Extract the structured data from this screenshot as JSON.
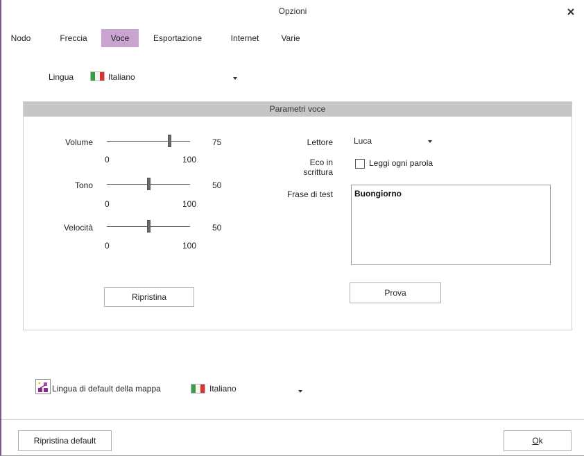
{
  "window": {
    "title": "Opzioni"
  },
  "tabs": [
    {
      "label": "Nodo",
      "active": false
    },
    {
      "label": "Freccia",
      "active": false
    },
    {
      "label": "Voce",
      "active": true
    },
    {
      "label": "Esportazione",
      "active": false
    },
    {
      "label": "Internet",
      "active": false
    },
    {
      "label": "Varie",
      "active": false
    }
  ],
  "language": {
    "label": "Lingua",
    "value": "Italiano",
    "flag": "italy-flag"
  },
  "voice_params": {
    "title": "Parametri voce",
    "volume": {
      "label": "Volume",
      "value": "75",
      "min": "0",
      "max": "100"
    },
    "tone": {
      "label": "Tono",
      "value": "50",
      "min": "0",
      "max": "100"
    },
    "speed": {
      "label": "Velocità",
      "value": "50",
      "min": "0",
      "max": "100"
    },
    "reset_button": "Ripristina",
    "reader": {
      "label": "Lettore",
      "value": "Luca"
    },
    "echo": {
      "label_line1": "Eco in",
      "label_line2": "scrittura",
      "checkbox_label": "Leggi ogni parola",
      "checked": false
    },
    "test_phrase": {
      "label": "Frase di test",
      "value": "Buongiorno"
    },
    "test_button": "Prova"
  },
  "map_language": {
    "label": "Lingua di default della mappa",
    "value": "Italiano",
    "flag": "italy-flag",
    "icon": "map-language-icon"
  },
  "footer": {
    "reset_default": "Ripristina default",
    "ok_accel": "O",
    "ok_rest": "k"
  },
  "colors": {
    "active_tab": "#c9a4d0",
    "group_header": "#c6c6c6",
    "window_border": "#7a5a8a"
  }
}
